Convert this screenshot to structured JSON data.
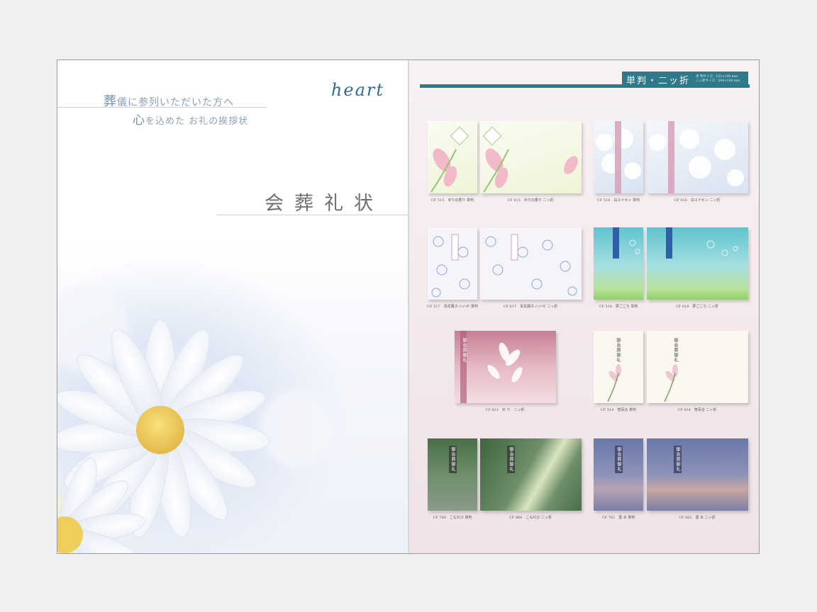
{
  "left_page": {
    "brand": "heart",
    "tagline_line1_big": "葬",
    "tagline_line1_rest": "儀に参列いただいた方へ",
    "tagline_line2_big": "心",
    "tagline_line2_rest": "を込めた お礼の挨拶状",
    "title": "会葬礼状"
  },
  "right_page": {
    "header_label": "単判・二ッ折",
    "size_line1": "単 判サイズ：102×148 mm",
    "size_line2": "二ッ折サイズ：204×148 mm",
    "card_inscription": "御会葬御礼",
    "captions": {
      "c1": "CF 515　ゆりの香り 単判",
      "c2": "CF 615　ゆりの香り 二ッ折",
      "c3": "CF 516　白スイセン 単判",
      "c4": "CF 616　白スイセン 二ッ折",
      "c5": "CF 517　青花風ホ-ハハギ 単判",
      "c6": "CF 617　青花風ホ-ハハギ 二ッ折",
      "c7": "CF 518　夢ごこち 単判",
      "c8": "CF 618　夢ごこち 二ッ折",
      "c9": "CF 613　ゆ り　二ッ折",
      "c10": "CF 514　笹百合 単判",
      "c11": "CF 614　笹百合 二ッ折",
      "c12": "CF 760　こもれび 単判",
      "c13": "CF 860　こもれび 二ッ折",
      "c14": "CF 762　雲 水 単判",
      "c15": "CF 862　雲 水 二ッ折"
    }
  },
  "colors": {
    "accent_teal": "#2f7a8a",
    "title_gray": "#6f6f6f",
    "tagline_blue": "#8aa2bd",
    "page_pink": "#f4e9ec"
  }
}
